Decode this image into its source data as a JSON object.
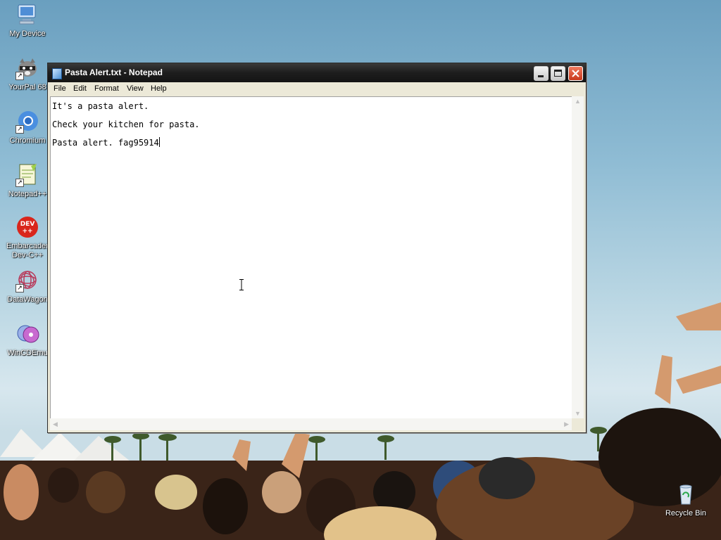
{
  "desktop": {
    "icons": [
      {
        "label": "My Device",
        "icon": "my-device-icon"
      },
      {
        "label": "YourPal 68",
        "icon": "yourpal-raccoon-icon"
      },
      {
        "label": "Chromium",
        "icon": "chromium-icon"
      },
      {
        "label": "Notepad++",
        "icon": "notepadpp-icon"
      },
      {
        "label": "Embarcader Dev-C++",
        "icon": "dev-cpp-icon"
      },
      {
        "label": "DataWagon",
        "icon": "datawagon-icon"
      },
      {
        "label": "WinCDEmu",
        "icon": "wincdemu-icon"
      },
      {
        "label": "Recycle Bin",
        "icon": "recycle-bin-icon"
      }
    ]
  },
  "notepad": {
    "title": "Pasta Alert.txt - Notepad",
    "menu": [
      "File",
      "Edit",
      "Format",
      "View",
      "Help"
    ],
    "lines": [
      "It's a pasta alert.",
      "Check your kitchen for pasta.",
      "Pasta alert. fag95914"
    ]
  },
  "colors": {
    "titlebar": "#1d1d1d",
    "close_button": "#d9482a",
    "window_frame": "#ece9d8"
  }
}
